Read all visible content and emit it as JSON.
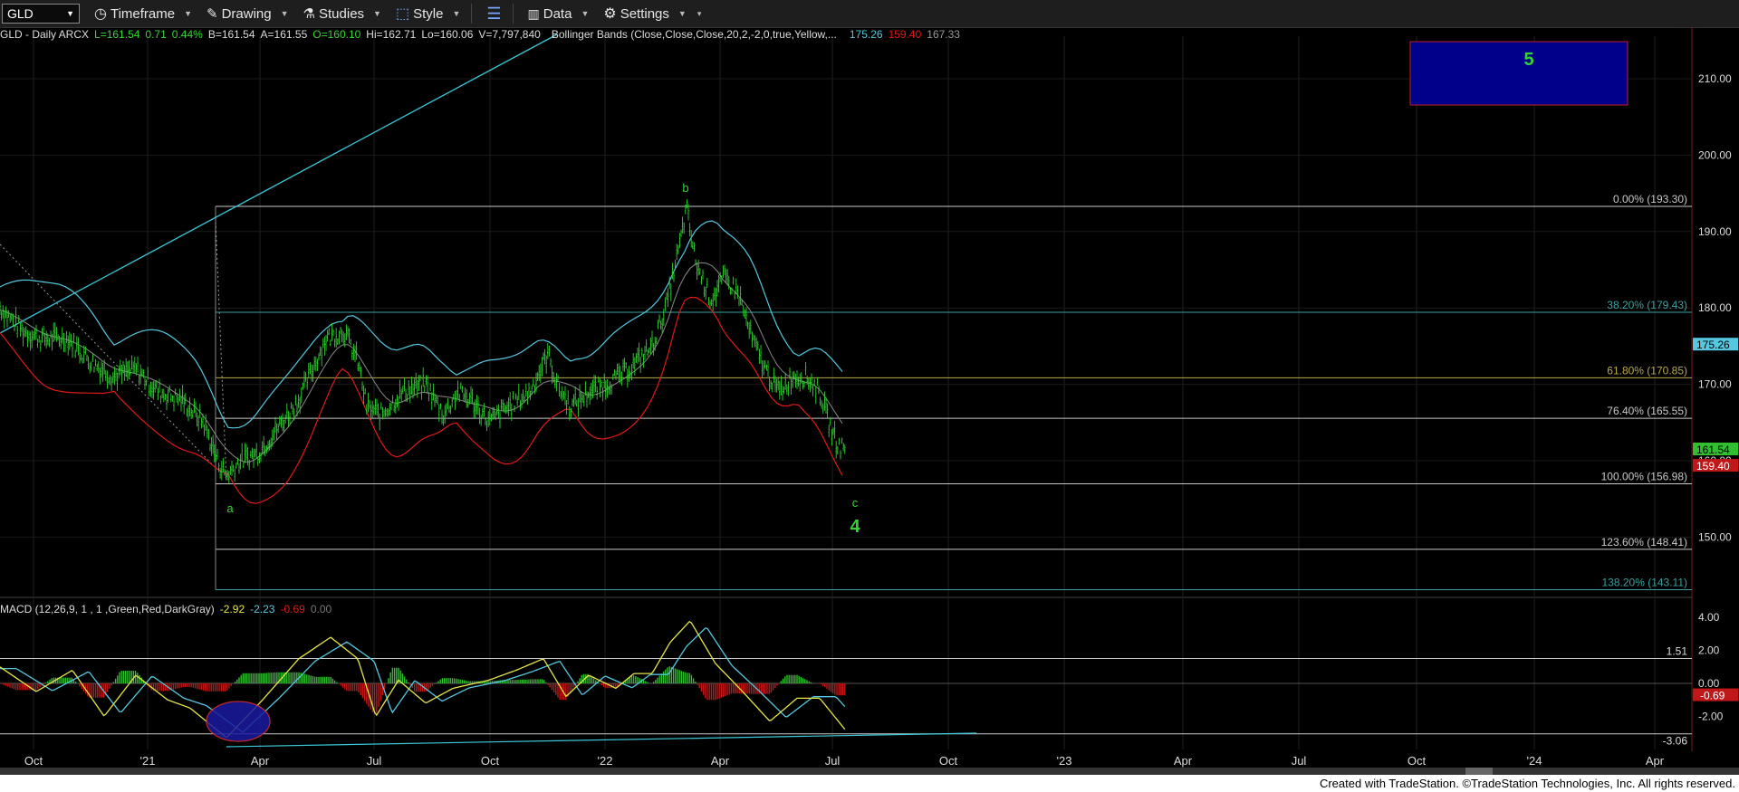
{
  "toolbar": {
    "symbol": "GLD",
    "timeframe": "Timeframe",
    "drawing": "Drawing",
    "studies": "Studies",
    "style": "Style",
    "data": "Data",
    "settings": "Settings"
  },
  "info": {
    "title": "GLD - Daily  ARCX",
    "last": "L=161.54",
    "change": "0.71",
    "pct": "0.44%",
    "bid": "B=161.54",
    "ask": "A=161.55",
    "open": "O=160.10",
    "high": "Hi=162.71",
    "low": "Lo=160.06",
    "volume": "V=7,797,840",
    "bollinger": "Bollinger Bands (Close,Close,Close,20,2,-2,0,true,Yellow,...",
    "bb_upper": "175.26",
    "bb_lower": "159.40",
    "bb_mid": "167.33"
  },
  "macd_info": {
    "title": "MACD (12,26,9, 1 , 1 ,Green,Red,DarkGray)",
    "v1": "-2.92",
    "v2": "-2.23",
    "v3": "-0.69",
    "v4": "0.00"
  },
  "price_axis": [
    "210.00",
    "200.00",
    "190.00",
    "180.00",
    "170.00",
    "160.00",
    "150.00"
  ],
  "price_tags": {
    "upper": "175.26",
    "last": "161.54",
    "lower": "159.40"
  },
  "macd_axis": [
    "4.00",
    "2.00",
    "0.00",
    "-2.00"
  ],
  "macd_tags": {
    "upper": "1.51",
    "current": "-0.69",
    "lower": "-3.06"
  },
  "time_axis": [
    "Oct",
    "'21",
    "Apr",
    "Jul",
    "Oct",
    "'22",
    "Apr",
    "Jul",
    "Oct",
    "'23",
    "Apr",
    "Jul",
    "Oct",
    "'24",
    "Apr"
  ],
  "fib_levels": [
    {
      "label": "0.00% (193.30)",
      "price": 193.3,
      "color": "#c8c8c8"
    },
    {
      "label": "38.20% (179.43)",
      "price": 179.43,
      "color": "#3aa0a0"
    },
    {
      "label": "61.80% (170.85)",
      "price": 170.85,
      "color": "#b8a84a"
    },
    {
      "label": "76.40% (165.55)",
      "price": 165.55,
      "color": "#c8c8c8"
    },
    {
      "label": "100.00% (156.98)",
      "price": 156.98,
      "color": "#c8c8c8"
    },
    {
      "label": "123.60% (148.41)",
      "price": 148.41,
      "color": "#c8c8c8"
    },
    {
      "label": "138.20% (143.11)",
      "price": 143.11,
      "color": "#3aa0a0"
    }
  ],
  "wave_labels": {
    "a": "a",
    "b": "b",
    "c": "c",
    "four": "4",
    "five": "5"
  },
  "colors": {
    "accent_green": "#33d633",
    "target_box": "#00008b",
    "upper_band": "#55c8e0",
    "lower_band": "#e01818"
  },
  "footer": "Created with TradeStation. ©TradeStation Technologies, Inc. All rights reserved."
}
